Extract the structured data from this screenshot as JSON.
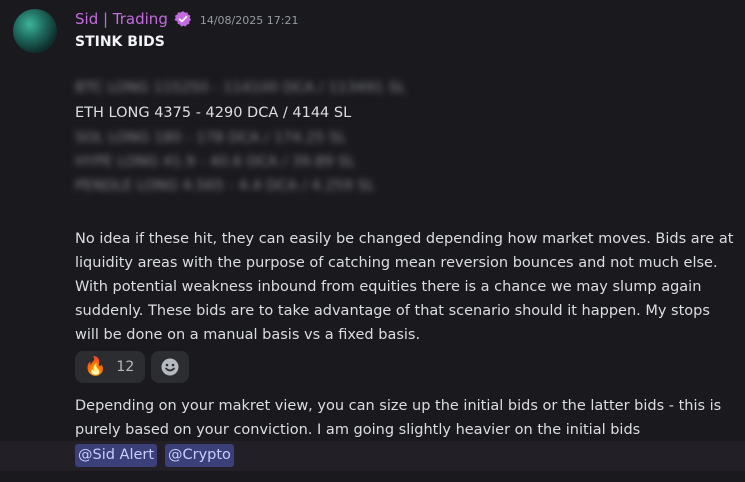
{
  "message": {
    "author": "Sid | Trading",
    "timestamp": "14/08/2025 17:21",
    "title": "STINK BIDS",
    "trade_lines": [
      {
        "text": "BTC LONG 115250 - 114100 DCA / 113491 SL",
        "blurred": true
      },
      {
        "text": "ETH LONG 4375 - 4290 DCA / 4144 SL",
        "blurred": false
      },
      {
        "text": "SOL LONG 180 - 178 DCA / 174.25 SL",
        "blurred": true
      },
      {
        "text": "HYPE LONG 41.9 - 40.6 DCA / 39.89 SL",
        "blurred": true
      },
      {
        "text": "PENDLE LONG 4.565 - 4.4 DCA / 4.259 SL",
        "blurred": true
      }
    ],
    "paragraph1": "No idea if these hit, they can easily be changed depending how market moves. Bids are at liquidity areas with the purpose of catching mean reversion bounces and not much else. With potential weakness inbound from equities there is a chance we may slump again suddenly. These bids are to take advantage of that scenario should it happen. My stops will be done on a manual basis vs a fixed basis.",
    "reactions": [
      {
        "emoji": "🔥",
        "count": "12"
      }
    ],
    "paragraph2": "Depending on your makret view, you can size up the initial bids or the latter bids - this is purely based on your conviction. I am going slightly heavier on the initial bids",
    "mentions": [
      "@Sid Alert",
      "@Crypto"
    ]
  },
  "colors": {
    "background": "#1a1a1e",
    "author": "#c46cdf",
    "mention_bg": "#3b3f7a",
    "mention_text": "#c9cdfb"
  }
}
